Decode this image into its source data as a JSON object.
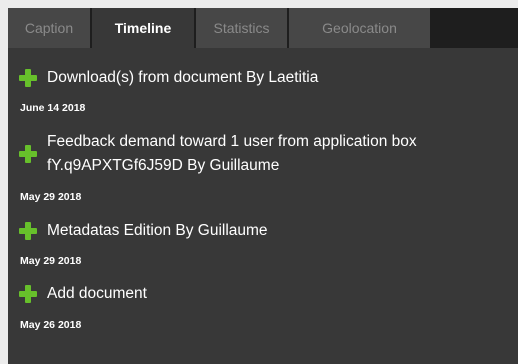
{
  "tabs": [
    {
      "label": "Caption",
      "active": false
    },
    {
      "label": "Timeline",
      "active": true
    },
    {
      "label": "Statistics",
      "active": false
    },
    {
      "label": "Geolocation",
      "active": false
    }
  ],
  "entries": [
    {
      "icon": "plus-icon",
      "title": "Download(s) from document By Laetitia",
      "date": "June 14 2018"
    },
    {
      "icon": "plus-icon",
      "title": "Feedback demand toward 1 user from application box fY.q9APXTGf6J59D By Guillaume",
      "date": "May 29 2018"
    },
    {
      "icon": "plus-icon",
      "title": "Metadatas Edition By Guillaume",
      "date": "May 29 2018"
    },
    {
      "icon": "plus-icon",
      "title": "Add document",
      "date": "May 26 2018"
    }
  ],
  "colors": {
    "tab_bar": "#1e1e1e",
    "tab_inactive": "#474747",
    "panel": "#383838",
    "plus_icon": "#67c02b",
    "text": "#ffffff"
  }
}
